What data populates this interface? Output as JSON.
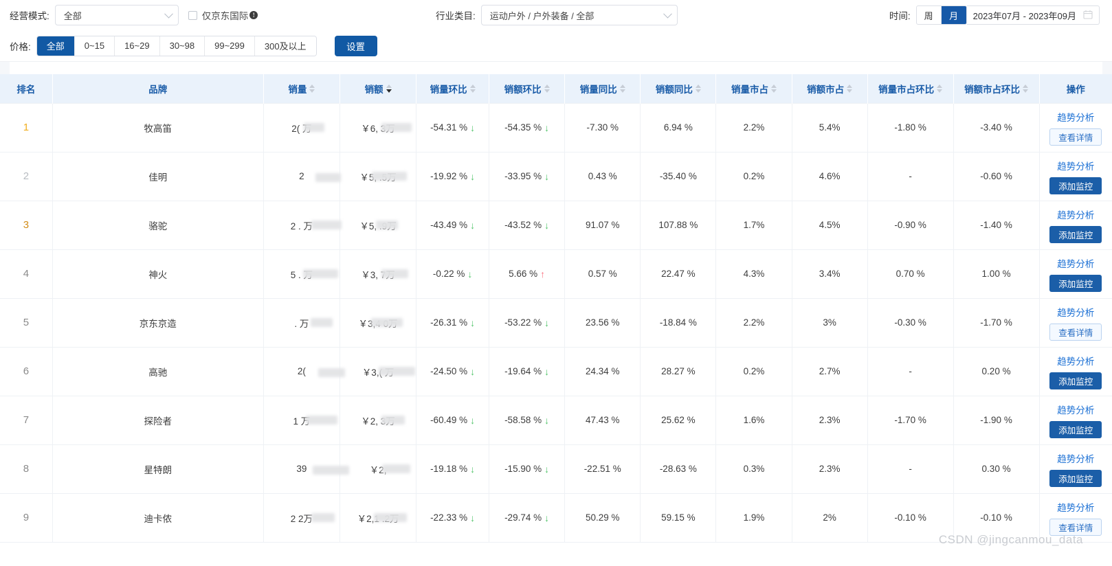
{
  "filters": {
    "business_mode": {
      "label": "经营模式:",
      "value": "全部",
      "options": [
        "全部"
      ]
    },
    "jd_international": {
      "label": "仅京东国际",
      "checked": false,
      "info_icon": "info-icon"
    },
    "category": {
      "label": "行业类目:",
      "value": "运动户外 / 户外装备 / 全部",
      "options": [
        "运动户外 / 户外装备 / 全部"
      ]
    },
    "time": {
      "label": "时间:",
      "granularity_options": [
        "周",
        "月"
      ],
      "granularity_active": "月",
      "range": "2023年07月 - 2023年09月",
      "calendar_icon": "calendar-icon"
    },
    "price": {
      "label": "价格:",
      "options": [
        "全部",
        "0~15",
        "16~29",
        "30~98",
        "99~299",
        "300及以上"
      ],
      "active": "全部"
    },
    "settings_button": "设置"
  },
  "table": {
    "columns": [
      {
        "label": "排名",
        "sortable": false,
        "sort": "none"
      },
      {
        "label": "品牌",
        "sortable": false,
        "sort": "none"
      },
      {
        "label": "销量",
        "sortable": true,
        "sort": "none"
      },
      {
        "label": "销额",
        "sortable": true,
        "sort": "desc"
      },
      {
        "label": "销量环比",
        "sortable": true,
        "sort": "none"
      },
      {
        "label": "销额环比",
        "sortable": true,
        "sort": "none"
      },
      {
        "label": "销量同比",
        "sortable": true,
        "sort": "none"
      },
      {
        "label": "销额同比",
        "sortable": true,
        "sort": "none"
      },
      {
        "label": "销量市占",
        "sortable": true,
        "sort": "none"
      },
      {
        "label": "销额市占",
        "sortable": true,
        "sort": "none"
      },
      {
        "label": "销量市占环比",
        "sortable": true,
        "sort": "none"
      },
      {
        "label": "销额市占环比",
        "sortable": true,
        "sort": "none"
      },
      {
        "label": "操作",
        "sortable": false,
        "sort": "none"
      }
    ],
    "rows": [
      {
        "rank": "1",
        "rank_style": "gold",
        "brand": "牧高笛",
        "sales_volume": "2(    万",
        "sales_amount": "￥6,    3万",
        "vol_mom": "-54.31 %",
        "vol_mom_dir": "down",
        "amt_mom": "-54.35 %",
        "amt_mom_dir": "down",
        "vol_yoy": "-7.30 %",
        "amt_yoy": "6.94 %",
        "vol_share": "2.2%",
        "amt_share": "5.4%",
        "vol_share_mom": "-1.80 %",
        "amt_share_mom": "-3.40 %",
        "trend_link": "趋势分析",
        "action_button": "查看详情",
        "action_style": "ghost"
      },
      {
        "rank": "2",
        "rank_style": "silver",
        "brand": "佳明",
        "sales_volume": "2        ",
        "sales_amount": "￥5,    .5万",
        "vol_mom": "-19.92 %",
        "vol_mom_dir": "down",
        "amt_mom": "-33.95 %",
        "amt_mom_dir": "down",
        "vol_yoy": "0.43 %",
        "amt_yoy": "-35.40 %",
        "vol_share": "0.2%",
        "amt_share": "4.6%",
        "vol_share_mom": "-",
        "amt_share_mom": "-0.60 %",
        "trend_link": "趋势分析",
        "action_button": "添加监控",
        "action_style": "solid"
      },
      {
        "rank": "3",
        "rank_style": "bronze",
        "brand": "骆驼",
        "sales_volume": "2 .  万",
        "sales_amount": "￥5,   .9万",
        "vol_mom": "-43.49 %",
        "vol_mom_dir": "down",
        "amt_mom": "-43.52 %",
        "amt_mom_dir": "down",
        "vol_yoy": "91.07 %",
        "amt_yoy": "107.88 %",
        "vol_share": "1.7%",
        "amt_share": "4.5%",
        "vol_share_mom": "-0.90 %",
        "amt_share_mom": "-1.40 %",
        "trend_link": "趋势分析",
        "action_button": "添加监控",
        "action_style": "solid"
      },
      {
        "rank": "4",
        "rank_style": "plain",
        "brand": "神火",
        "sales_volume": "5 . 万",
        "sales_amount": "￥3,   7万",
        "vol_mom": "-0.22 %",
        "vol_mom_dir": "down",
        "amt_mom": "5.66 %",
        "amt_mom_dir": "up",
        "vol_yoy": "0.57 %",
        "amt_yoy": "22.47 %",
        "vol_share": "4.3%",
        "amt_share": "3.4%",
        "vol_share_mom": "0.70 %",
        "amt_share_mom": "1.00 %",
        "trend_link": "趋势分析",
        "action_button": "添加监控",
        "action_style": "solid"
      },
      {
        "rank": "5",
        "rank_style": "plain",
        "brand": "京东京造",
        "sales_volume": "  . 万",
        "sales_amount": "￥3,4   0万",
        "vol_mom": "-26.31 %",
        "vol_mom_dir": "down",
        "amt_mom": "-53.22 %",
        "amt_mom_dir": "down",
        "vol_yoy": "23.56 %",
        "amt_yoy": "-18.84 %",
        "vol_share": "2.2%",
        "amt_share": "3%",
        "vol_share_mom": "-0.30 %",
        "amt_share_mom": "-1.70 %",
        "trend_link": "趋势分析",
        "action_button": "查看详情",
        "action_style": "ghost"
      },
      {
        "rank": "6",
        "rank_style": "plain",
        "brand": "高驰",
        "sales_volume": "2(     ",
        "sales_amount": "￥3,(    万",
        "vol_mom": "-24.50 %",
        "vol_mom_dir": "down",
        "amt_mom": "-19.64 %",
        "amt_mom_dir": "down",
        "vol_yoy": "24.34 %",
        "amt_yoy": "28.27 %",
        "vol_share": "0.2%",
        "amt_share": "2.7%",
        "vol_share_mom": "-",
        "amt_share_mom": "0.20 %",
        "trend_link": "趋势分析",
        "action_button": "添加监控",
        "action_style": "solid"
      },
      {
        "rank": "7",
        "rank_style": "plain",
        "brand": "探险者",
        "sales_volume": "1   万",
        "sales_amount": "￥2,   3万",
        "vol_mom": "-60.49 %",
        "vol_mom_dir": "down",
        "amt_mom": "-58.58 %",
        "amt_mom_dir": "down",
        "vol_yoy": "47.43 %",
        "amt_yoy": "25.62 %",
        "vol_share": "1.6%",
        "amt_share": "2.3%",
        "vol_share_mom": "-1.70 %",
        "amt_share_mom": "-1.90 %",
        "trend_link": "趋势分析",
        "action_button": "添加监控",
        "action_style": "solid"
      },
      {
        "rank": "8",
        "rank_style": "plain",
        "brand": "星特朗",
        "sales_volume": "39      ",
        "sales_amount": "￥2,      ",
        "vol_mom": "-19.18 %",
        "vol_mom_dir": "down",
        "amt_mom": "-15.90 %",
        "amt_mom_dir": "down",
        "vol_yoy": "-22.51 %",
        "amt_yoy": "-28.63 %",
        "vol_share": "0.3%",
        "amt_share": "2.3%",
        "vol_share_mom": "-",
        "amt_share_mom": "0.30 %",
        "trend_link": "趋势分析",
        "action_button": "添加监控",
        "action_style": "solid"
      },
      {
        "rank": "9",
        "rank_style": "plain",
        "brand": "迪卡侬",
        "sales_volume": "2   2万",
        "sales_amount": "￥2,1 .2万",
        "vol_mom": "-22.33 %",
        "vol_mom_dir": "down",
        "amt_mom": "-29.74 %",
        "amt_mom_dir": "down",
        "vol_yoy": "50.29 %",
        "amt_yoy": "59.15 %",
        "vol_share": "1.9%",
        "amt_share": "2%",
        "vol_share_mom": "-0.10 %",
        "amt_share_mom": "-0.10 %",
        "trend_link": "趋势分析",
        "action_button": "查看详情",
        "action_style": "ghost"
      }
    ]
  },
  "watermark": "CSDN @jingcanmou_data",
  "colors": {
    "primary": "#1159a4",
    "header_bg": "#eaf2fb",
    "header_text": "#1a5ca8",
    "up": "#fb6f7e",
    "down": "#52c46a",
    "rank_gold": "#f0ad1e",
    "rank_silver": "#b8bcc2",
    "rank_bronze": "#d28d19"
  }
}
